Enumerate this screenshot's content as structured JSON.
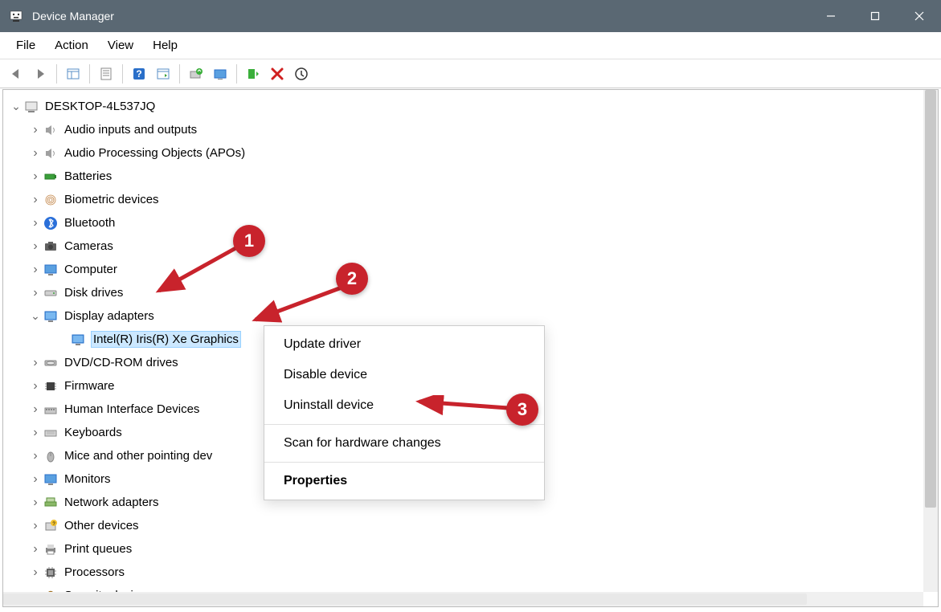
{
  "window": {
    "title": "Device Manager"
  },
  "menu": {
    "file": "File",
    "action": "Action",
    "view": "View",
    "help": "Help"
  },
  "tree": {
    "root": "DESKTOP-4L537JQ",
    "audio_inputs": "Audio inputs and outputs",
    "audio_proc": "Audio Processing Objects (APOs)",
    "batteries": "Batteries",
    "biometric": "Biometric devices",
    "bluetooth": "Bluetooth",
    "cameras": "Cameras",
    "computer": "Computer",
    "disk_drives": "Disk drives",
    "display_adapters": "Display adapters",
    "intel_iris": "Intel(R) Iris(R) Xe Graphics",
    "dvd": "DVD/CD-ROM drives",
    "firmware": "Firmware",
    "hid": "Human Interface Devices",
    "keyboards": "Keyboards",
    "mice": "Mice and other pointing dev",
    "monitors": "Monitors",
    "network": "Network adapters",
    "other": "Other devices",
    "print_queues": "Print queues",
    "processors": "Processors",
    "security": "Security devices"
  },
  "context_menu": {
    "update": "Update driver",
    "disable": "Disable device",
    "uninstall": "Uninstall device",
    "scan": "Scan for hardware changes",
    "properties": "Properties"
  },
  "callouts": {
    "c1": "1",
    "c2": "2",
    "c3": "3"
  }
}
